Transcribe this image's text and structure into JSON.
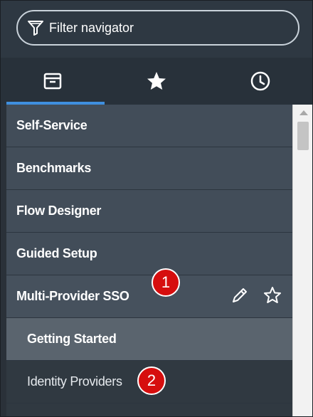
{
  "filter": {
    "placeholder": "Filter navigator"
  },
  "tabs": [
    {
      "icon": "archive-icon",
      "active": true
    },
    {
      "icon": "star-icon",
      "active": false
    },
    {
      "icon": "clock-icon",
      "active": false
    }
  ],
  "nav": {
    "items": [
      {
        "label": "Self-Service"
      },
      {
        "label": "Benchmarks"
      },
      {
        "label": "Flow Designer"
      },
      {
        "label": "Guided Setup"
      },
      {
        "label": "Multi-Provider SSO"
      },
      {
        "label": "Getting Started"
      },
      {
        "label": "Identity Providers"
      }
    ]
  },
  "badges": {
    "one": "1",
    "two": "2"
  },
  "colors": {
    "accent": "#3f8fdf",
    "badge": "#d60e0e"
  }
}
